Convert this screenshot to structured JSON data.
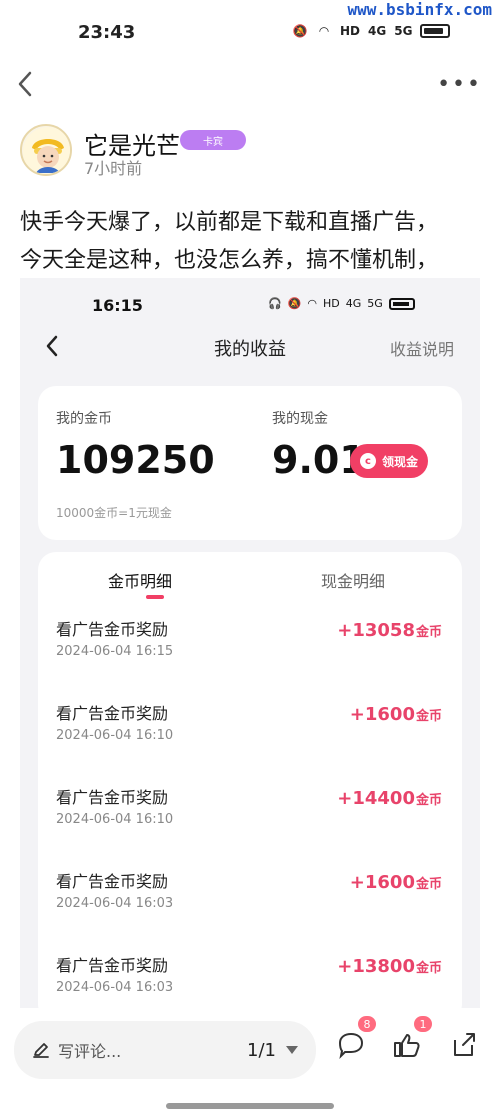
{
  "statusbar": {
    "time": "23:43",
    "icons": [
      "bell-off",
      "wifi",
      "HD",
      "4G",
      "5G",
      "battery"
    ],
    "watermark": "www.bsbinfx.com"
  },
  "top_nav": {
    "back_icon": "chevron-left",
    "more_icon": "more-horizontal"
  },
  "author": {
    "name": "它是光芒",
    "badge": "卡宾",
    "meta": "7小时前"
  },
  "post": {
    "line1": "快手今天爆了，以前都是下载和直播广告，",
    "line2": "今天全是这种，也没怎么养，搞不懂机制，"
  },
  "embedded_screenshot": {
    "statusbar": {
      "time": "16:15",
      "icons": [
        "headphones",
        "bell-off",
        "wifi",
        "HD",
        "4G",
        "5G",
        "battery"
      ]
    },
    "header": {
      "title": "我的收益",
      "link": "收益说明",
      "back_icon": "chevron-left"
    },
    "summary": {
      "coin_label": "我的金币",
      "coin_value": "109250",
      "cash_label": "我的现金",
      "cash_value": "9.01",
      "withdraw_button": "领现金",
      "exchange_rate": "10000金币=1元现金"
    },
    "tabs": {
      "active": "金币明细",
      "inactive": "现金明细"
    },
    "records": [
      {
        "title": "看广告金币奖励",
        "date": "2024-06-04 16:15",
        "amount": "+13058",
        "unit": "金币"
      },
      {
        "title": "看广告金币奖励",
        "date": "2024-06-04 16:10",
        "amount": "+1600",
        "unit": "金币"
      },
      {
        "title": "看广告金币奖励",
        "date": "2024-06-04 16:10",
        "amount": "+14400",
        "unit": "金币"
      },
      {
        "title": "看广告金币奖励",
        "date": "2024-06-04 16:03",
        "amount": "+1600",
        "unit": "金币"
      },
      {
        "title": "看广告金币奖励",
        "date": "2024-06-04 16:03",
        "amount": "+13800",
        "unit": "金币"
      }
    ]
  },
  "bottom_bar": {
    "comment_placeholder": "写评论...",
    "page_indicator": "1/1",
    "comment_count": "8",
    "like_count": "1",
    "icons": [
      "edit-icon",
      "comment-icon",
      "like-icon",
      "share-icon"
    ]
  },
  "colors": {
    "accent": "#f13f65",
    "amount_pink": "#e8436a",
    "watermark_blue": "#1f57c8",
    "panel_bg": "#f3f3f6"
  }
}
